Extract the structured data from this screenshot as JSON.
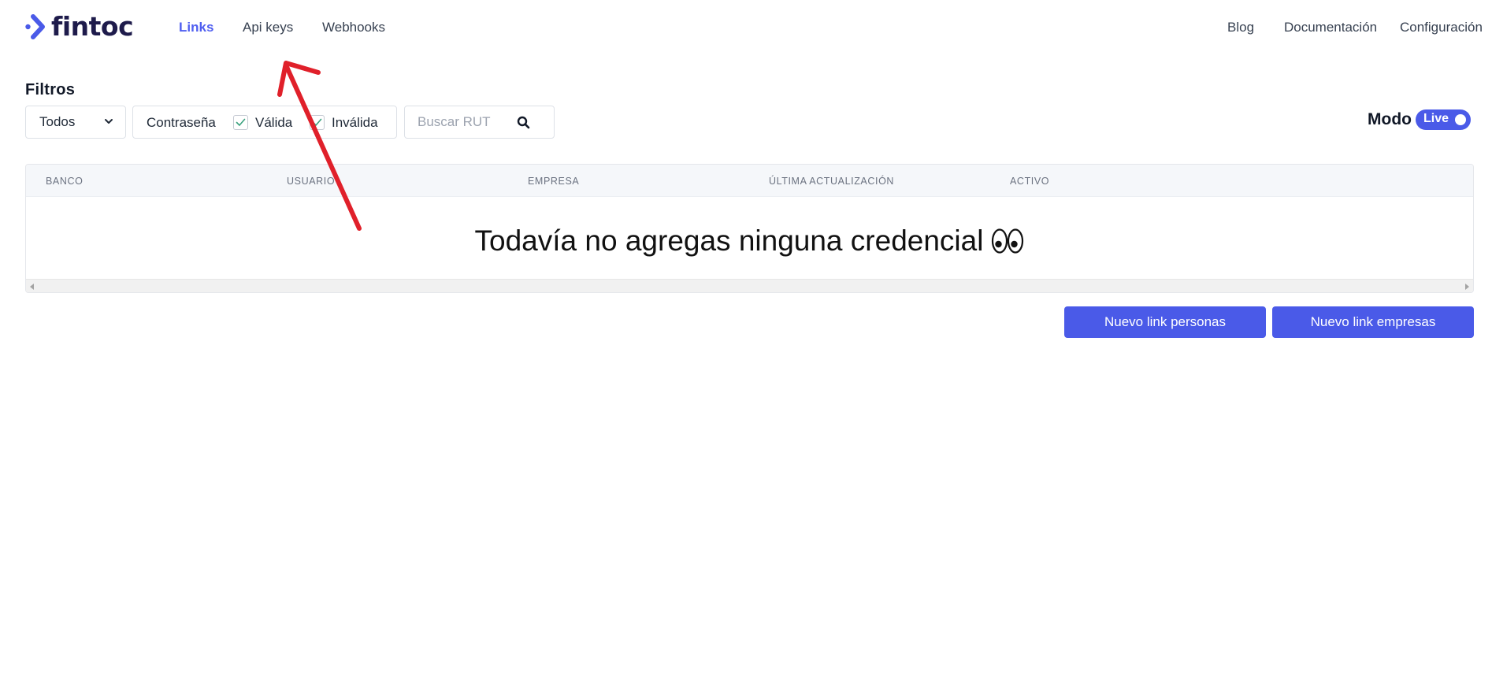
{
  "nav": {
    "brand": "fintoc",
    "links_left": [
      {
        "label": "Links",
        "active": true
      },
      {
        "label": "Api keys",
        "active": false
      },
      {
        "label": "Webhooks",
        "active": false
      }
    ],
    "links_right": [
      {
        "label": "Blog"
      },
      {
        "label": "Documentación"
      },
      {
        "label": "Configuración"
      }
    ]
  },
  "filters": {
    "title": "Filtros",
    "select_value": "Todos",
    "password_label": "Contraseña",
    "valid_label": "Válida",
    "valid_checked": true,
    "invalid_label": "Inválida",
    "invalid_checked": true,
    "search_placeholder": "Buscar RUT",
    "search_value": ""
  },
  "mode": {
    "label": "Modo",
    "toggle_label": "Live",
    "live": true
  },
  "table": {
    "columns": [
      "BANCO",
      "USUARIO",
      "EMPRESA",
      "ÚLTIMA ACTUALIZACIÓN",
      "ACTIVO"
    ],
    "rows": [],
    "empty_message": "Todavía no agregas ninguna credencial"
  },
  "actions": {
    "new_personas": "Nuevo link personas",
    "new_empresas": "Nuevo link empresas"
  },
  "colors": {
    "brand": "#4a5ae8",
    "active_link": "#4f5ef0",
    "annotation": "#e0202a",
    "check": "#3aa17e"
  },
  "icons": [
    "fintoc-logo-icon",
    "chevron-down-icon",
    "check-icon",
    "search-icon",
    "eyes-emoji-icon",
    "annotation-arrow"
  ]
}
